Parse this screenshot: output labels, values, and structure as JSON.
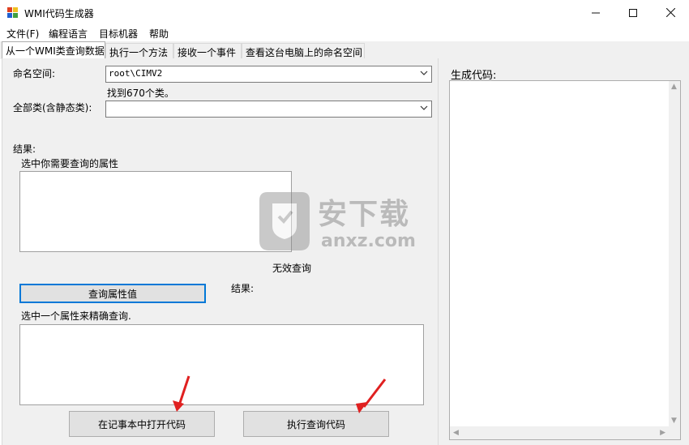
{
  "window": {
    "title": "WMI代码生成器"
  },
  "menu": {
    "items": [
      "文件(F)",
      "编程语言",
      "目标机器",
      "帮助"
    ]
  },
  "tabs": [
    {
      "label": "从一个WMI类查询数据",
      "active": true
    },
    {
      "label": "执行一个方法",
      "active": false
    },
    {
      "label": "接收一个事件",
      "active": false
    },
    {
      "label": "查看这台电脑上的命名空间",
      "active": false
    }
  ],
  "query": {
    "namespace_label": "命名空间:",
    "namespace_value": "root\\CIMV2",
    "found_classes": "找到670个类。",
    "all_classes_label": "全部类(含静态类):",
    "all_classes_value": "",
    "results_label": "结果:",
    "select_props_label": "选中你需要查询的属性",
    "invalid_query": "无效查询",
    "query_values_button": "查询属性值",
    "results_label_2": "结果:",
    "select_one_prop_label": "选中一个属性来精确查询.",
    "open_notepad_button": "在记事本中打开代码",
    "execute_button": "执行查询代码"
  },
  "code_panel": {
    "title": "生成代码:"
  },
  "watermark": {
    "text_cn": "安下载",
    "text_en": "anxz.com"
  },
  "colors": {
    "accent": "#0078d7",
    "arrow": "#e02020",
    "window_bg": "#f0f0f0"
  }
}
